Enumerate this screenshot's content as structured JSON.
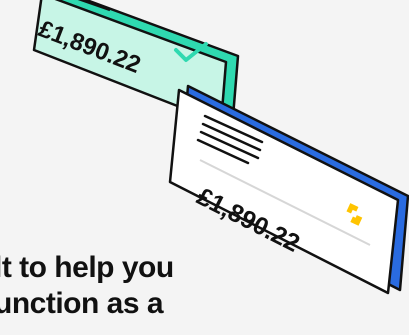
{
  "cards": {
    "back_card": {
      "amount": "£1,890.22",
      "fill_color": "#c7f5e6",
      "edge_color": "#2fd9b0",
      "outline_color": "#111111",
      "icon": "check-icon"
    },
    "front_card": {
      "amount": "£1,890.22",
      "fill_color": "#ffffff",
      "edge_color": "#2a6be0",
      "outline_color": "#111111",
      "icon": "sparkle-icon",
      "icon_color": "#ffc400"
    }
  },
  "heading": {
    "line1": "lt to help you",
    "line2": "unction as a"
  }
}
